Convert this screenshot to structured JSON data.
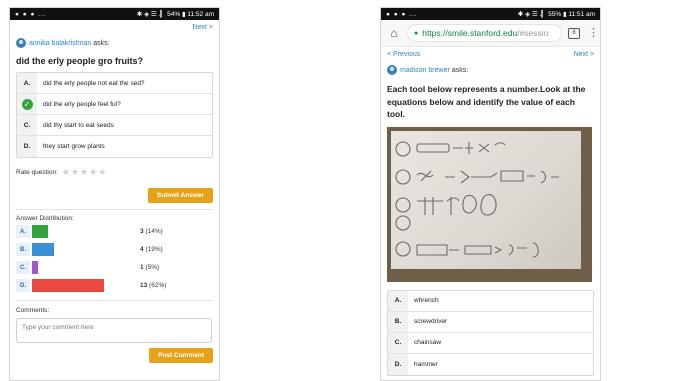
{
  "left": {
    "status": {
      "icons": "● ● ● ...",
      "right": "✱ ◈ ☰ .▎ 54% ▮ 11:52 am"
    },
    "nav": {
      "next": "Next >"
    },
    "asker": {
      "name": "annika balakrishnan",
      "suffix": "asks:"
    },
    "question": "did the erly people gro fruits?",
    "options": [
      {
        "letter": "A.",
        "text": "did the erly people not eat the sed?",
        "correct": false
      },
      {
        "letter": "",
        "text": "did the erly people feel ful?",
        "correct": true
      },
      {
        "letter": "C.",
        "text": "did thy start to eat seeds",
        "correct": false
      },
      {
        "letter": "D.",
        "text": "they start grow plants",
        "correct": false
      }
    ],
    "rate": {
      "label": "Rate question:",
      "stars": "★★★★★"
    },
    "submit_label": "Submit Answer",
    "distribution": {
      "title": "Answer Distribution:",
      "rows": [
        {
          "letter": "A.",
          "count": "3",
          "pct": "(14%)",
          "fraction": 0.14,
          "color": "#2fa43a"
        },
        {
          "letter": "B.",
          "count": "4",
          "pct": "(19%)",
          "fraction": 0.19,
          "color": "#3a8fd6"
        },
        {
          "letter": "C.",
          "count": "1",
          "pct": "(5%)",
          "fraction": 0.05,
          "color": "#9b59c9"
        },
        {
          "letter": "D.",
          "count": "13",
          "pct": "(62%)",
          "fraction": 0.62,
          "color": "#e9493f"
        }
      ]
    },
    "comments": {
      "label": "Comments:",
      "placeholder": "Type your comment here",
      "post_label": "Post Comment"
    }
  },
  "right": {
    "status": {
      "icons": "● ● ● ...",
      "right": "✱ ◈ ☰ .▎ 55% ▮ 11:51 am"
    },
    "browser": {
      "url_main": "https://smile.stanford.edu",
      "url_dim": "/#sessio",
      "tabs_count": "8"
    },
    "nav": {
      "prev": "< Previous",
      "next": "Next >"
    },
    "asker": {
      "name": "madison brewer",
      "suffix": "asks:"
    },
    "question": "Each tool below represents a number.Look at the equations below and identify the value of each tool.",
    "options": [
      {
        "letter": "A.",
        "text": "whrench"
      },
      {
        "letter": "B.",
        "text": "screwdriver"
      },
      {
        "letter": "C.",
        "text": "chainsaw"
      },
      {
        "letter": "D.",
        "text": "hammer"
      }
    ]
  }
}
